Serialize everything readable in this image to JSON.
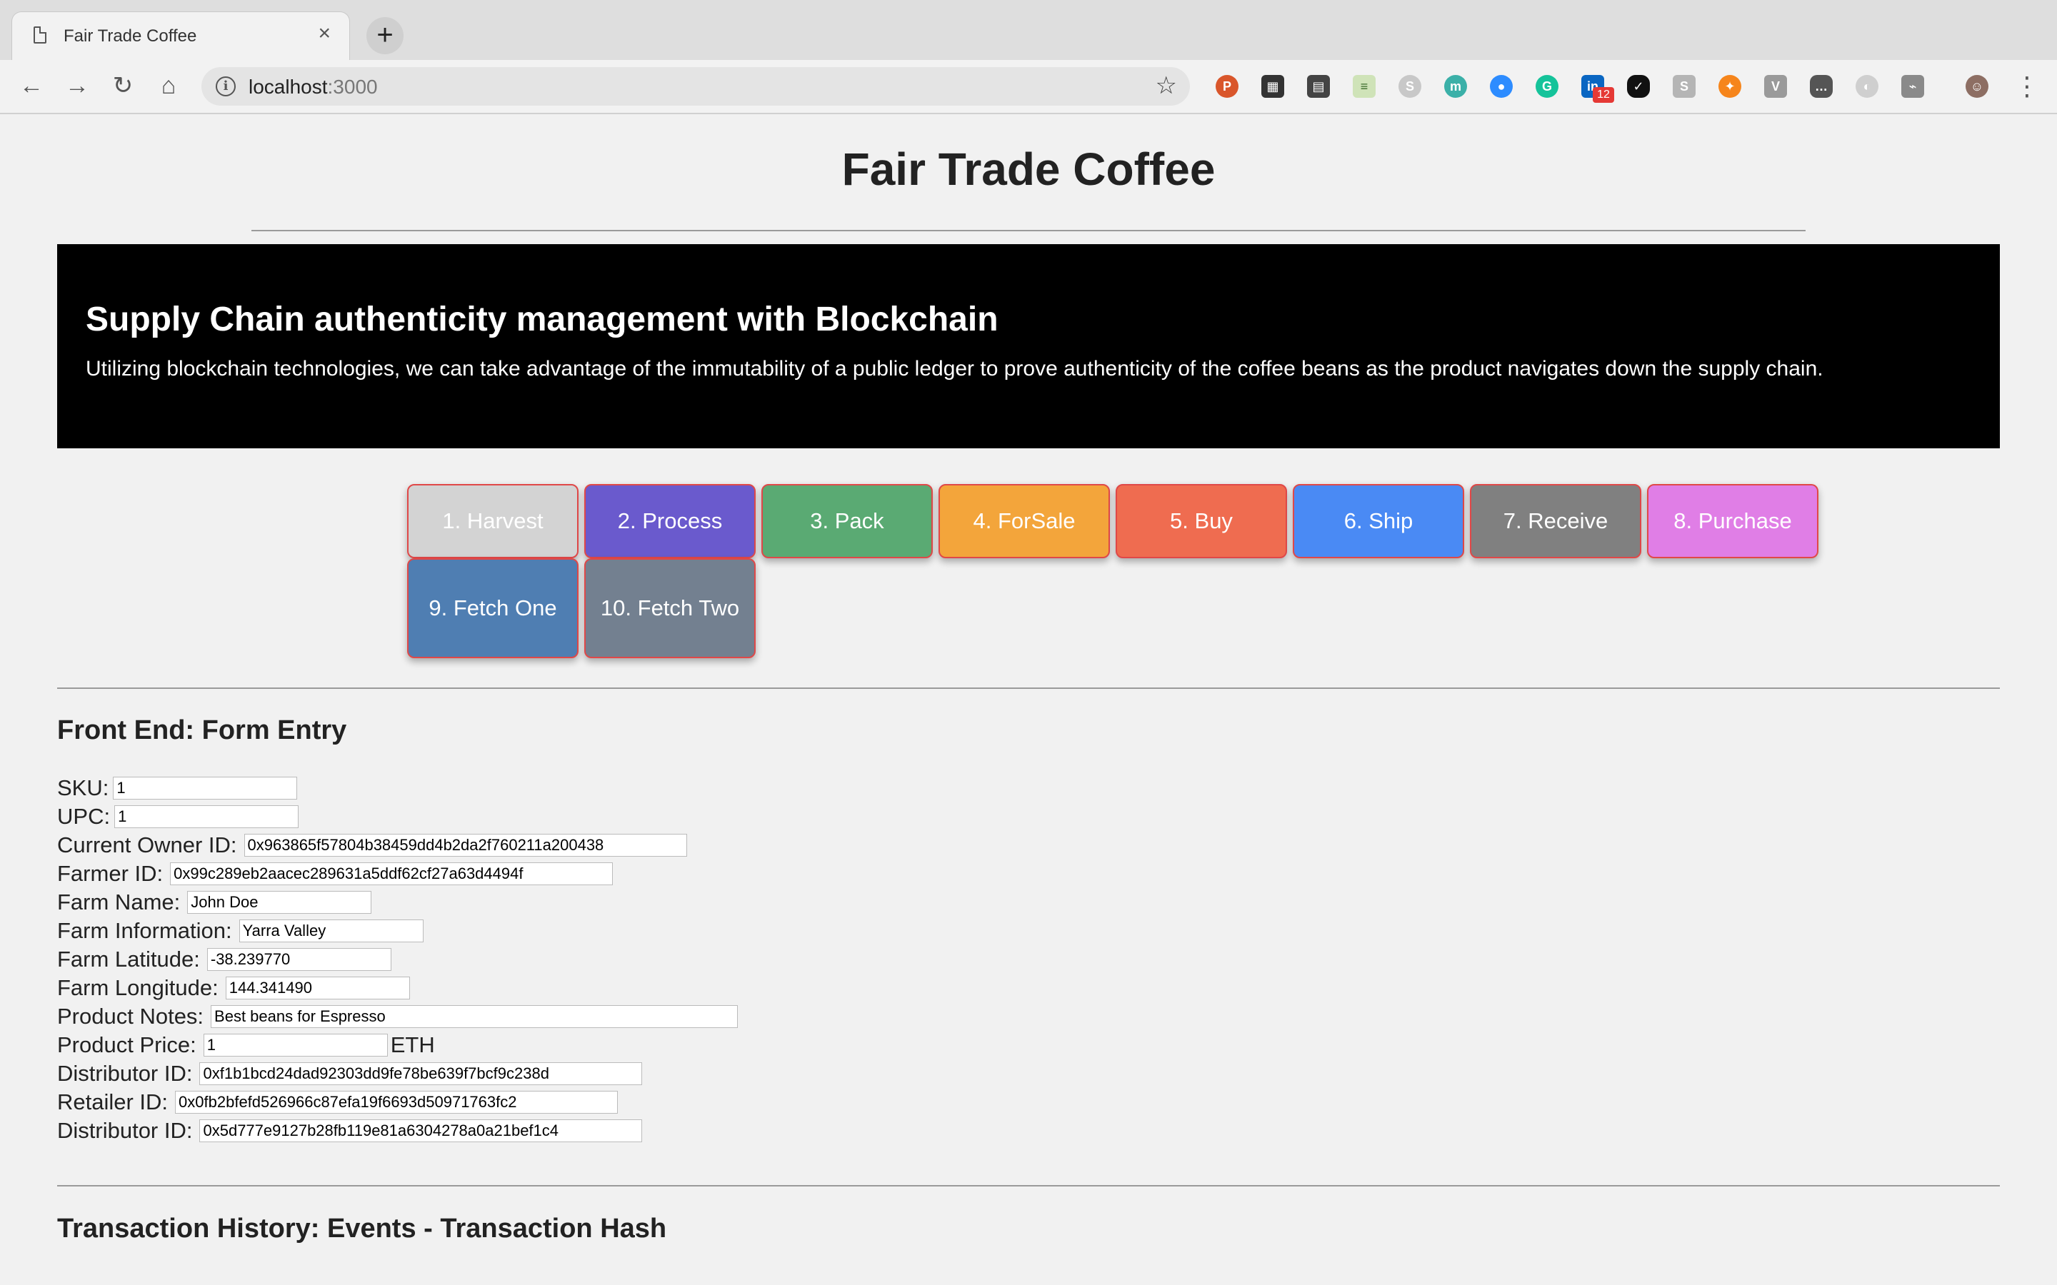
{
  "browser": {
    "tab_title": "Fair Trade Coffee",
    "tab_close": "×",
    "new_tab": "+",
    "url_host": "localhost",
    "url_port": ":3000",
    "extension_badge": "12"
  },
  "page": {
    "title": "Fair Trade Coffee",
    "banner": {
      "heading": "Supply Chain authenticity management with Blockchain",
      "text": "Utilizing blockchain technologies, we can take advantage of the immutability of a public ledger to prove authenticity of the coffee beans as the product navigates down the supply chain."
    },
    "buttons": [
      {
        "label": "1. Harvest",
        "color": "#d3d3d3"
      },
      {
        "label": "2. Process",
        "color": "#6a5acd"
      },
      {
        "label": "3. Pack",
        "color": "#5aaa73"
      },
      {
        "label": "4. ForSale",
        "color": "#f3a53b"
      },
      {
        "label": "5. Buy",
        "color": "#ef6c50"
      },
      {
        "label": "6. Ship",
        "color": "#4a8af4"
      },
      {
        "label": "7. Receive",
        "color": "#808080"
      },
      {
        "label": "8. Purchase",
        "color": "#e07ee6"
      },
      {
        "label": "9. Fetch One",
        "color": "#4f7eb2"
      },
      {
        "label": "10. Fetch Two",
        "color": "#738090"
      }
    ],
    "form": {
      "heading": "Front End: Form Entry",
      "sku": {
        "label": "SKU:",
        "value": "1"
      },
      "upc": {
        "label": "UPC:",
        "value": "1"
      },
      "owner_id": {
        "label": "Current Owner ID:",
        "value": "0x963865f57804b38459dd4b2da2f760211a200438"
      },
      "farmer_id": {
        "label": "Farmer ID:",
        "value": "0x99c289eb2aacec289631a5ddf62cf27a63d4494f"
      },
      "farm_name": {
        "label": "Farm Name:",
        "value": "John Doe"
      },
      "farm_info": {
        "label": "Farm Information:",
        "value": "Yarra Valley"
      },
      "farm_lat": {
        "label": "Farm Latitude:",
        "value": "-38.239770"
      },
      "farm_long": {
        "label": "Farm Longitude:",
        "value": "144.341490"
      },
      "notes": {
        "label": "Product Notes:",
        "value": "Best beans for Espresso"
      },
      "price": {
        "label": "Product Price:",
        "value": "1",
        "unit": "ETH"
      },
      "distributor_id": {
        "label": "Distributor ID:",
        "value": "0xf1b1bcd24dad92303dd9fe78be639f7bcf9c238d"
      },
      "retailer_id": {
        "label": "Retailer ID:",
        "value": "0x0fb2bfefd526966c87efa19f6693d50971763fc2"
      },
      "consumer_id": {
        "label": "Distributor ID:",
        "value": "0x5d777e9127b28fb119e81a6304278a0a21bef1c4"
      }
    },
    "history_heading": "Transaction History: Events - Transaction Hash"
  }
}
